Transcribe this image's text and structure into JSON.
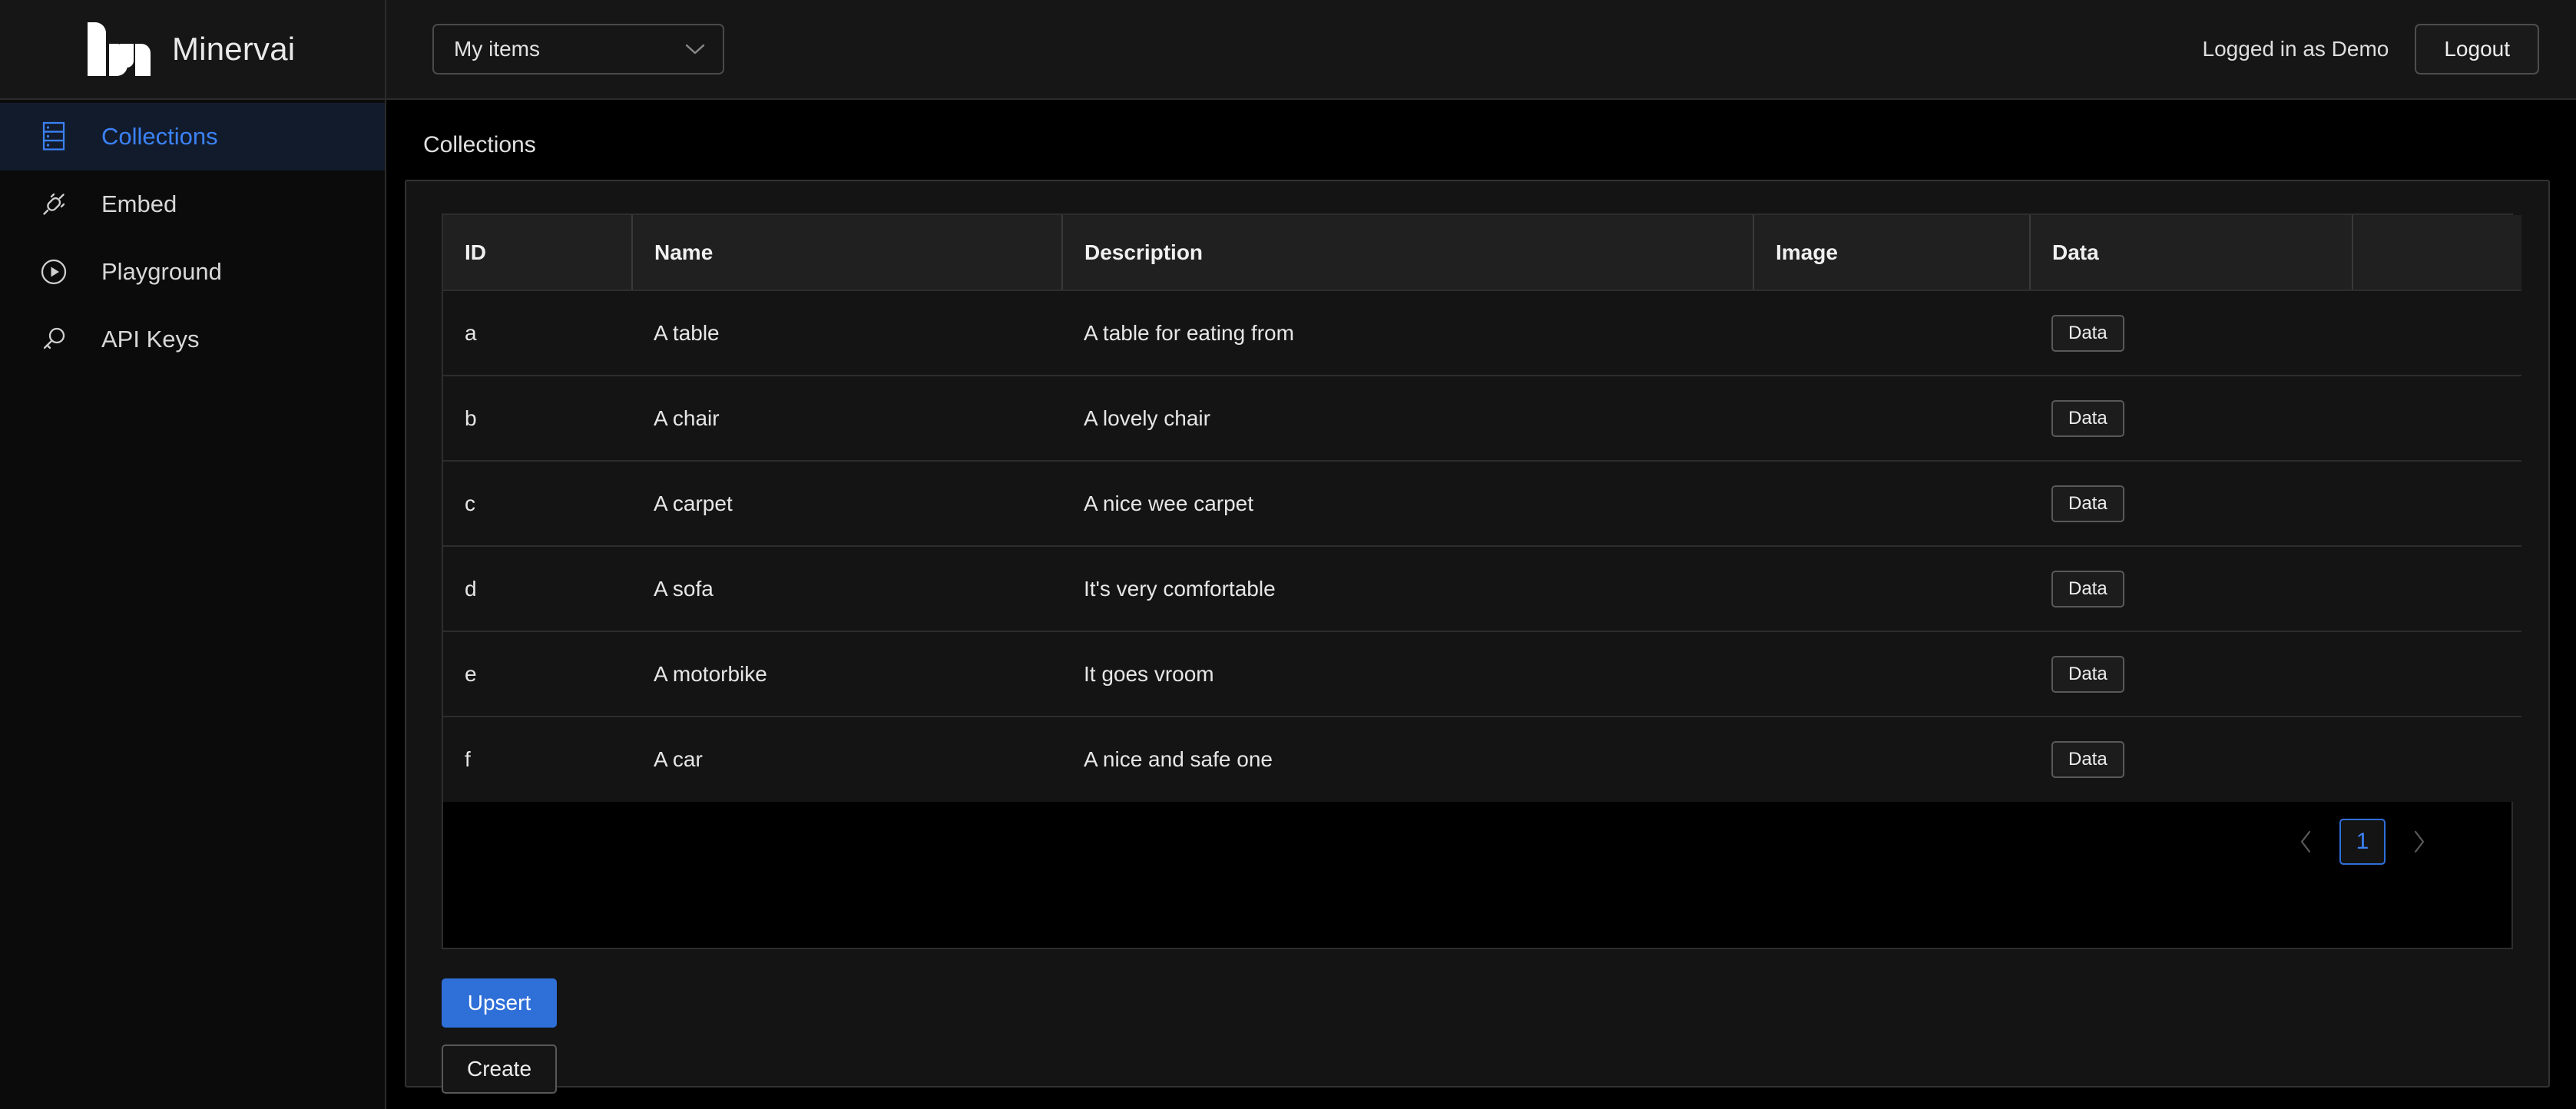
{
  "brand": {
    "name": "Minervai",
    "logo_icon": "minervai-bm-logo"
  },
  "topbar": {
    "collection_select": {
      "value": "My items",
      "chevron_icon": "chevron-down-icon"
    },
    "session_text": "Logged in as Demo",
    "logout_label": "Logout"
  },
  "sidebar": {
    "items": [
      {
        "label": "Collections",
        "icon": "database-icon",
        "active": true
      },
      {
        "label": "Embed",
        "icon": "plug-connector-icon",
        "active": false
      },
      {
        "label": "Playground",
        "icon": "play-circle-icon",
        "active": false
      },
      {
        "label": "API Keys",
        "icon": "key-icon",
        "active": false
      }
    ]
  },
  "main": {
    "page_title": "Collections",
    "table": {
      "columns": [
        "ID",
        "Name",
        "Description",
        "Image",
        "Data",
        ""
      ],
      "rows": [
        {
          "id": "a",
          "name": "A table",
          "description": "A table for eating from",
          "image": "",
          "data_label": "Data"
        },
        {
          "id": "b",
          "name": "A chair",
          "description": "A lovely chair",
          "image": "",
          "data_label": "Data"
        },
        {
          "id": "c",
          "name": "A carpet",
          "description": "A nice wee carpet",
          "image": "",
          "data_label": "Data"
        },
        {
          "id": "d",
          "name": "A sofa",
          "description": "It's very comfortable",
          "image": "",
          "data_label": "Data"
        },
        {
          "id": "e",
          "name": "A motorbike",
          "description": "It goes vroom",
          "image": "",
          "data_label": "Data"
        },
        {
          "id": "f",
          "name": "A car",
          "description": "A nice and safe one",
          "image": "",
          "data_label": "Data"
        }
      ]
    },
    "pagination": {
      "prev_icon": "chevron-left-icon",
      "next_icon": "chevron-right-icon",
      "current_page": "1"
    },
    "actions": {
      "upsert_label": "Upsert",
      "create_label": "Create"
    }
  },
  "colors": {
    "accent_blue": "#2f6fd8",
    "active_text_blue": "#3b82f6",
    "active_nav_bg": "#121b2c",
    "page_bg": "#000000",
    "card_bg": "#141414",
    "header_row_bg": "#202020"
  }
}
